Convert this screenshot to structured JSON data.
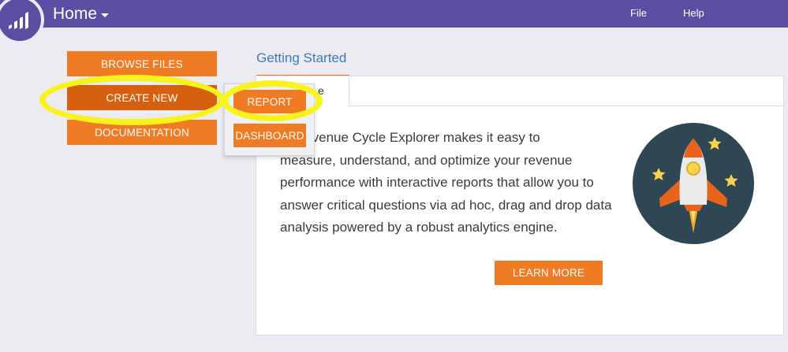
{
  "header": {
    "title": "Home",
    "nav": [
      "File",
      "Help"
    ]
  },
  "sidebar": {
    "browse_label": "BROWSE FILES",
    "create_label": "CREATE NEW",
    "docs_label": "DOCUMENTATION"
  },
  "dropdown": {
    "items": [
      "REPORT",
      "DASHBOARD"
    ]
  },
  "main": {
    "tab_label": "Getting Started",
    "subtab_label": "e",
    "body_lines": [
      "to Revenue Cycle Explorer makes it easy to",
      "measure, understand, and optimize your revenue",
      "performance with interactive reports that allow you to",
      "answer critical questions via ad hoc, drag and drop data",
      "analysis powered by a robust analytics engine."
    ],
    "learn_more_label": "LEARN MORE"
  },
  "colors": {
    "header": "#5c4fa3",
    "accent": "#ef7b25",
    "highlight": "#f8f31c",
    "link": "#3d7ab8"
  }
}
